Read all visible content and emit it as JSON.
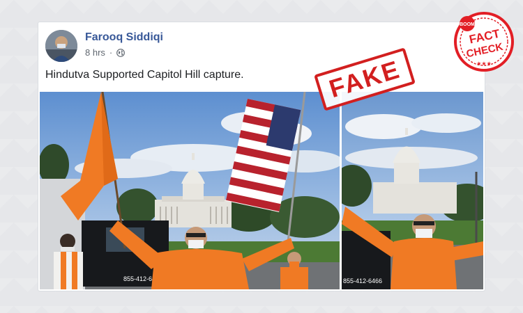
{
  "post": {
    "author": "Farooq Siddiqi",
    "timestamp": "8 hrs",
    "privacy_icon": "globe-icon",
    "text": "Hindutva Supported Capitol Hill capture."
  },
  "stamp": {
    "label": "FAKE"
  },
  "logo": {
    "brand": "BOOM",
    "line1": "FACT",
    "line2": "CHECK",
    "color": "#e21e25"
  },
  "photo": {
    "truck_phone": "855-412-6466"
  },
  "colors": {
    "link": "#385898",
    "saffron": "#f07a24",
    "stamp_red": "#d21f1f"
  }
}
